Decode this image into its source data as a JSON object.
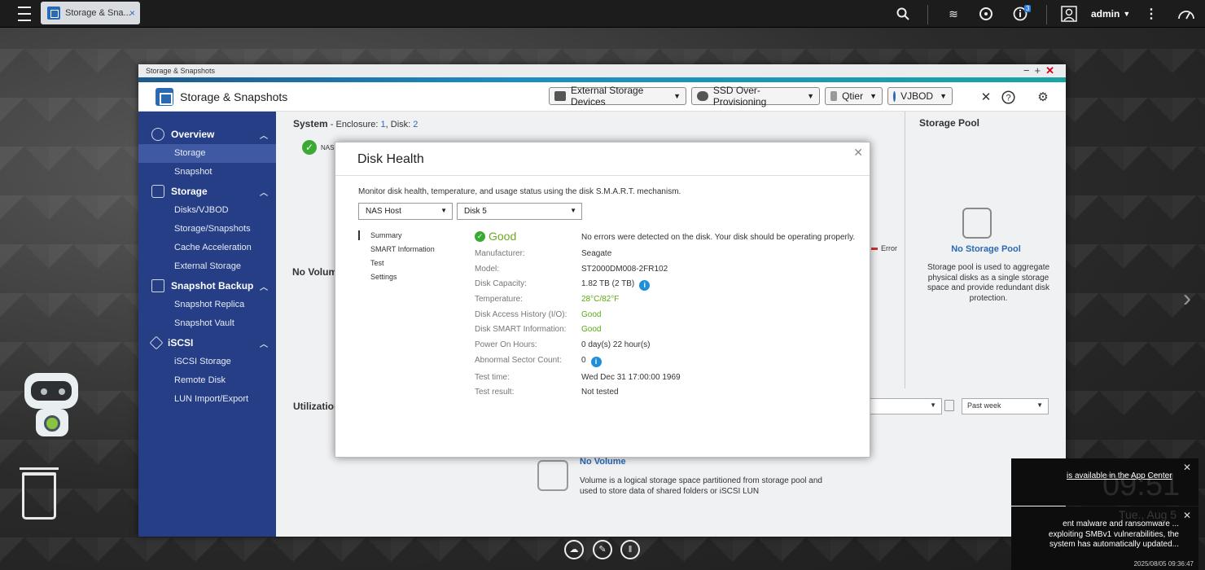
{
  "topbar": {
    "tab_title": "Storage & Sna...",
    "user": "admin",
    "notif_count": "3"
  },
  "window": {
    "title": "Storage & Snapshots",
    "app_title": "Storage & Snapshots",
    "header_buttons": [
      {
        "label": "External Storage Devices"
      },
      {
        "label": "SSD Over-Provisioning"
      },
      {
        "label": "Qtier"
      },
      {
        "label": "VJBOD"
      }
    ]
  },
  "sidebar": {
    "sections": [
      {
        "label": "Overview",
        "items": [
          "Storage",
          "Snapshot"
        ]
      },
      {
        "label": "Storage",
        "items": [
          "Disks/VJBOD",
          "Storage/Snapshots",
          "Cache Acceleration",
          "External Storage"
        ]
      },
      {
        "label": "Snapshot Backup",
        "items": [
          "Snapshot Replica",
          "Snapshot Vault"
        ]
      },
      {
        "label": "iSCSI",
        "items": [
          "iSCSI Storage",
          "Remote Disk",
          "LUN Import/Export"
        ]
      }
    ]
  },
  "content": {
    "system_label": "System",
    "enclosure_text": " - Enclosure: ",
    "enclosure_count": "1",
    "disk_text": ", Disk: ",
    "disk_count": "2",
    "nas_label": "NAS",
    "error_legend": "Error",
    "no_volume": "No Volume",
    "utilization": "Utilization",
    "period": "Past week",
    "storage_pool_title": "Storage Pool",
    "no_pool_link": "No Storage Pool",
    "no_pool_text": "Storage pool is used to aggregate physical disks as a single storage space and provide redundant disk protection.",
    "no_volume_link": "No Volume",
    "no_volume_text": "Volume is a logical storage space partitioned from storage pool and used to store data of shared folders or iSCSI LUN"
  },
  "dialog": {
    "title": "Disk Health",
    "description": "Monitor disk health, temperature, and usage status using the disk S.M.A.R.T. mechanism.",
    "host_select": "NAS Host",
    "disk_select": "Disk 5",
    "nav": [
      "Summary",
      "SMART Information",
      "Test",
      "Settings"
    ],
    "status": "Good",
    "status_message": "No errors were detected on the disk. Your disk should be operating properly.",
    "rows": [
      {
        "key": "Manufacturer:",
        "value": "Seagate"
      },
      {
        "key": "Model:",
        "value": "ST2000DM008-2FR102"
      },
      {
        "key": "Disk Capacity:",
        "value": "1.82 TB (2 TB)"
      },
      {
        "key": "Temperature:",
        "value": "28°C/82°F"
      },
      {
        "key": "Disk Access History (I/O):",
        "value": "Good"
      },
      {
        "key": "Disk SMART Information:",
        "value": "Good"
      },
      {
        "key": "Power On Hours:",
        "value": "0 day(s) 22 hour(s)"
      },
      {
        "key": "Abnormal Sector Count:",
        "value": "0"
      },
      {
        "key": "Test time:",
        "value": "Wed Dec 31 17:00:00 1969"
      },
      {
        "key": "Test result:",
        "value": "Not tested"
      }
    ]
  },
  "notifications": {
    "n1_text": "is available in the App Center",
    "n1_clock": "09:51",
    "n2_text": "ent malware and ransomware ... exploiting SMBv1 vulnerabilities, the system has automatically updated...",
    "n2_date": "Tue., Aug 5",
    "n2_stamp": "2025/08/05 09:36:47"
  },
  "colors": {
    "sidebar": "#253e86",
    "accent_blue": "#2a6ab5",
    "good_green": "#5aaa14"
  }
}
